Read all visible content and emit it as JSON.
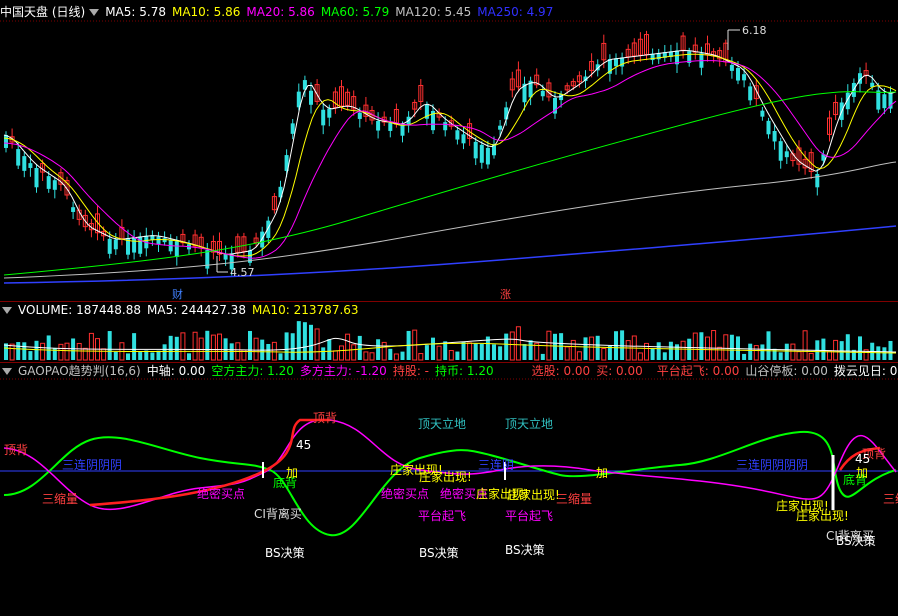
{
  "price": {
    "title": "中国天盘 (日线)",
    "ma": [
      {
        "label": "MA5: 5.78",
        "color": "#ffffff"
      },
      {
        "label": "MA10: 5.86",
        "color": "#ffff00"
      },
      {
        "label": "MA20: 5.86",
        "color": "#ff00ff"
      },
      {
        "label": "MA60: 5.79",
        "color": "#00ff00"
      },
      {
        "label": "MA120: 5.45",
        "color": "#c0c0c0"
      },
      {
        "label": "MA250: 4.97",
        "color": "#3030ff"
      }
    ],
    "high_label": "6.18",
    "low_label": "4.57",
    "marker_cai": "财",
    "marker_zhang": "涨"
  },
  "volume": {
    "labels": [
      {
        "label": "VOLUME: 187448.88",
        "color": "#ffffff"
      },
      {
        "label": "MA5: 244427.38",
        "color": "#ffffff"
      },
      {
        "label": "MA10: 213787.63",
        "color": "#ffff00"
      }
    ]
  },
  "indicator": {
    "labels": [
      {
        "label": "GAOPAO趋势判(16,6)",
        "color": "#c0c0c0"
      },
      {
        "label": "中轴: 0.00",
        "color": "#ffffff"
      },
      {
        "label": "空方主力: 1.20",
        "color": "#00ff00"
      },
      {
        "label": "多方主力: -1.20",
        "color": "#ff00ff"
      },
      {
        "label": "持股: -",
        "color": "#ff4040"
      },
      {
        "label": "持币: 1.20",
        "color": "#00ff00"
      },
      {
        "label": "选股: 0.00",
        "color": "#ff4040"
      },
      {
        "label": "买: 0.00",
        "color": "#ff4040"
      },
      {
        "label": "平台起飞: 0.00",
        "color": "#ff4040"
      },
      {
        "label": "山谷停板: 0.00",
        "color": "#c0c0c0"
      },
      {
        "label": "拨云见日: 0.00",
        "color": "#ffffff"
      }
    ],
    "annotations": {
      "top_back_1": "顶背",
      "top_back_2": "顶背",
      "top_back_3": "顶背",
      "num_45_1": "45",
      "num_45_2": "45",
      "sky_1": "顶天立地",
      "sky_2": "顶天立地",
      "three_shrink_1": "三缩量",
      "three_shrink_2": "三缩量",
      "three_shrink_3": "三缩量",
      "three_neg_1": "三连阴阴阴",
      "three_neg_2": "三连阴阴阴阴",
      "three_neg_3": "三连阴",
      "secret_buy_1": "绝密买点",
      "secret_buy_2": "绝密买点",
      "secret_buy_3": "绝密买点",
      "ci_buy_1": "CI背离买",
      "ci_buy_2": "CI背离买",
      "bottom_back_1": "底背",
      "bottom_back_2": "底背",
      "add_1": "加",
      "add_2": "加",
      "add_3": "加",
      "dealer_1": "庄家出现!",
      "dealer_2": "庄家出现!",
      "dealer_3": "庄家出现!",
      "dealer_4": "庄家出现!",
      "dealer_5": "庄家出现!",
      "dealer_6": "庄家出现!",
      "platform_1": "平台起飞",
      "platform_2": "平台起飞",
      "bs_1": "BS决策",
      "bs_2": "BS决策",
      "bs_3": "BS决策",
      "bs_4": "BS决策"
    }
  }
}
